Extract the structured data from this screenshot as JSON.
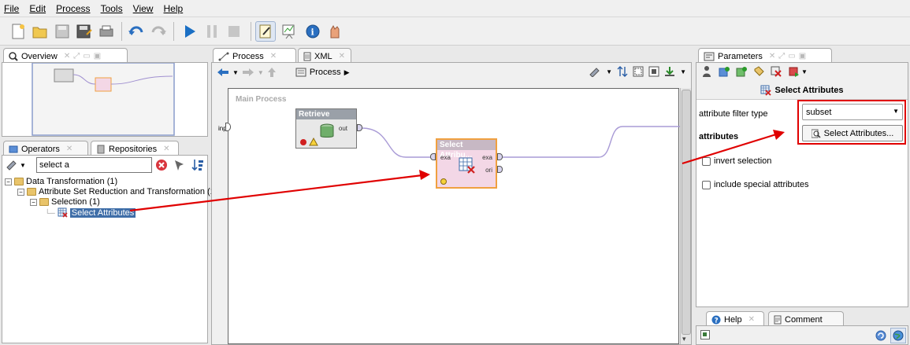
{
  "menu": [
    "File",
    "Edit",
    "Process",
    "Tools",
    "View",
    "Help"
  ],
  "overview": {
    "tab_label": "Overview"
  },
  "left_tabs": {
    "operators": "Operators",
    "repositories": "Repositories"
  },
  "search": {
    "value": "select a"
  },
  "tree": [
    {
      "label": "Data Transformation (1)"
    },
    {
      "label": "Attribute Set Reduction and Transformation (1"
    },
    {
      "label": "Selection (1)"
    },
    {
      "label": "Select Attributes"
    }
  ],
  "process_tabs": {
    "process": "Process",
    "xml": "XML"
  },
  "breadcrumb": {
    "label": "Process"
  },
  "canvas": {
    "title": "Main Process",
    "inp_label": "inp",
    "retrieve": {
      "title": "Retrieve",
      "out": "out"
    },
    "select": {
      "title": "Select Attribu...",
      "in_exa": "exa",
      "out_exa": "exa",
      "out_ori": "ori"
    }
  },
  "parameters": {
    "tab_label": "Parameters",
    "operator_title": "Select Attributes",
    "filter_type_label": "attribute filter type",
    "filter_type_value": "subset",
    "attributes_label": "attributes",
    "select_button": "Select Attributes...",
    "invert_selection": "invert selection",
    "include_special": "include special attributes"
  },
  "bottom_tabs": {
    "help": "Help",
    "comment": "Comment"
  },
  "colors": {
    "highlight": "#e00000",
    "operator_bg": "#f3d7e6",
    "operator_border": "#f0a040",
    "selection": "#3f6ea8"
  }
}
